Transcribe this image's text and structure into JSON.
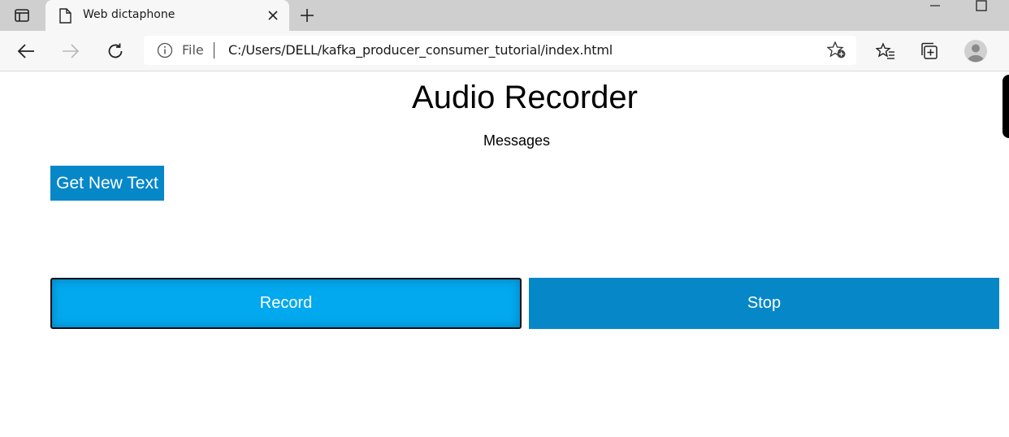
{
  "browser": {
    "tab": {
      "title": "Web dictaphone"
    },
    "address_bar": {
      "scheme_label": "File",
      "url": "C:/Users/DELL/kafka_producer_consumer_tutorial/index.html"
    }
  },
  "page": {
    "title": "Audio Recorder",
    "messages": "Messages",
    "buttons": {
      "get_new_text": "Get New Text",
      "record": "Record",
      "stop": "Stop"
    }
  },
  "colors": {
    "primary_button": "#0687c8",
    "record_button_active": "#03a9ee",
    "tabstrip": "#cfcfcf"
  },
  "icons": [
    "tab-actions-icon",
    "page-icon",
    "close-icon",
    "plus-icon",
    "minimize-icon",
    "maximize-icon",
    "back-arrow-icon",
    "forward-arrow-icon",
    "refresh-icon",
    "info-icon",
    "add-favorite-icon",
    "favorites-icon",
    "collections-icon",
    "profile-icon"
  ]
}
